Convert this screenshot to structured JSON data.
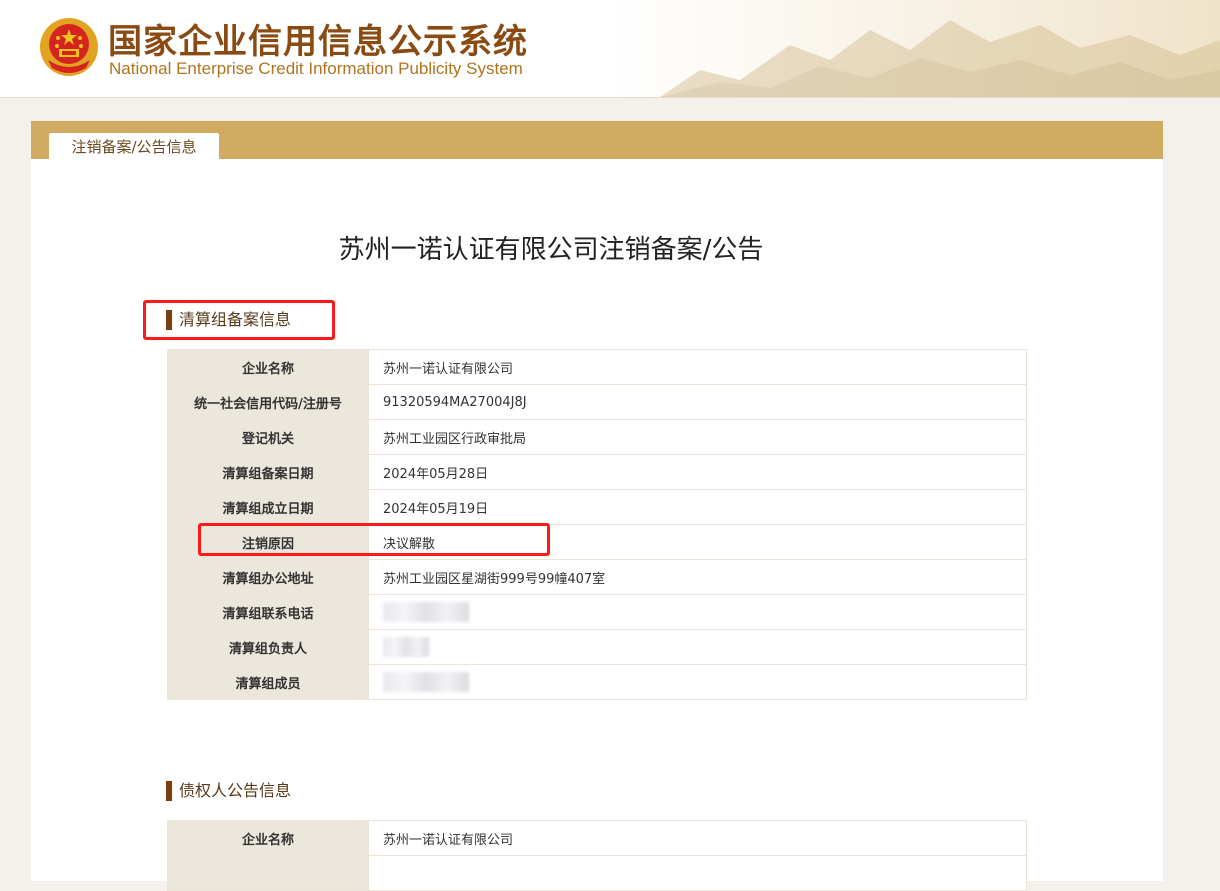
{
  "header": {
    "title_cn": "国家企业信用信息公示系统",
    "title_en": "National Enterprise Credit Information Publicity System"
  },
  "tab": {
    "label": "注销备案/公告信息"
  },
  "notice": {
    "title": "苏州一诺认证有限公司注销备案/公告"
  },
  "section1": {
    "title": "清算组备案信息",
    "rows": [
      {
        "label": "企业名称",
        "value": "苏州一诺认证有限公司"
      },
      {
        "label": "统一社会信用代码/注册号",
        "value": "91320594MA27004J8J"
      },
      {
        "label": "登记机关",
        "value": "苏州工业园区行政审批局"
      },
      {
        "label": "清算组备案日期",
        "value": "2024年05月28日"
      },
      {
        "label": "清算组成立日期",
        "value": "2024年05月19日"
      },
      {
        "label": "注销原因",
        "value": "决议解散"
      },
      {
        "label": "清算组办公地址",
        "value": "苏州工业园区星湖街999号99幢407室"
      },
      {
        "label": "清算组联系电话",
        "value": ""
      },
      {
        "label": "清算组负责人",
        "value": ""
      },
      {
        "label": "清算组成员",
        "value": ""
      }
    ]
  },
  "section2": {
    "title": "债权人公告信息",
    "rows": [
      {
        "label": "企业名称",
        "value": "苏州一诺认证有限公司"
      }
    ]
  },
  "icons": {
    "emblem": "national-emblem-icon"
  },
  "colors": {
    "brand_brown": "#8a4b12",
    "bar_gold": "#d2ab63",
    "highlight_red": "#ff1a1a"
  }
}
